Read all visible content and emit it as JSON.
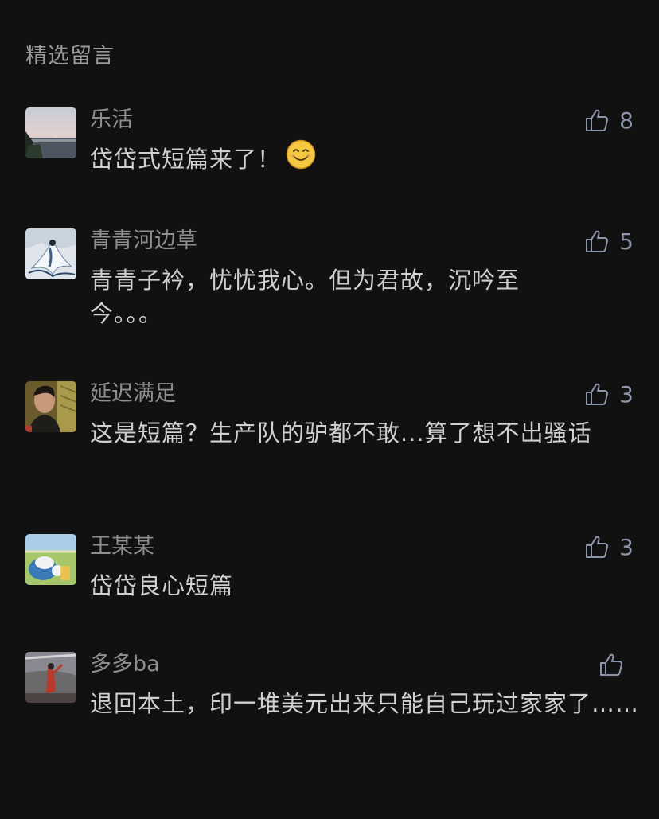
{
  "section": {
    "title": "精选留言"
  },
  "comments": [
    {
      "nickname": "乐活",
      "content": "岱岱式短篇来了！",
      "likes": "8",
      "avatar": "sunset-lake-photo",
      "has_emoji": true,
      "emoji": "smile-emoji"
    },
    {
      "nickname": "青青河边草",
      "content": "青青子衿，忧忧我心。但为君故，沉吟至今。。。",
      "likes": "5",
      "avatar": "white-robed-figure-painting"
    },
    {
      "nickname": "延迟满足",
      "content": "这是短篇？生产队的驴都不敢...算了想不出骚话",
      "likes": "3",
      "avatar": "man-portrait-photo"
    },
    {
      "nickname": "王某某",
      "content": "岱岱良心短篇",
      "likes": "3",
      "avatar": "cartoon-character-field"
    },
    {
      "nickname": "多多ba",
      "content": "退回本土，印一堆美元出来只能自己玩过家家了……",
      "likes": "",
      "avatar": "red-figure-photo"
    }
  ],
  "colors": {
    "background": "#111111",
    "like_icon": "#8d95a8",
    "nickname": "#8e8e8e",
    "content": "#cfcfcf"
  },
  "icons": {
    "like": "thumbs-up-outline-icon"
  }
}
